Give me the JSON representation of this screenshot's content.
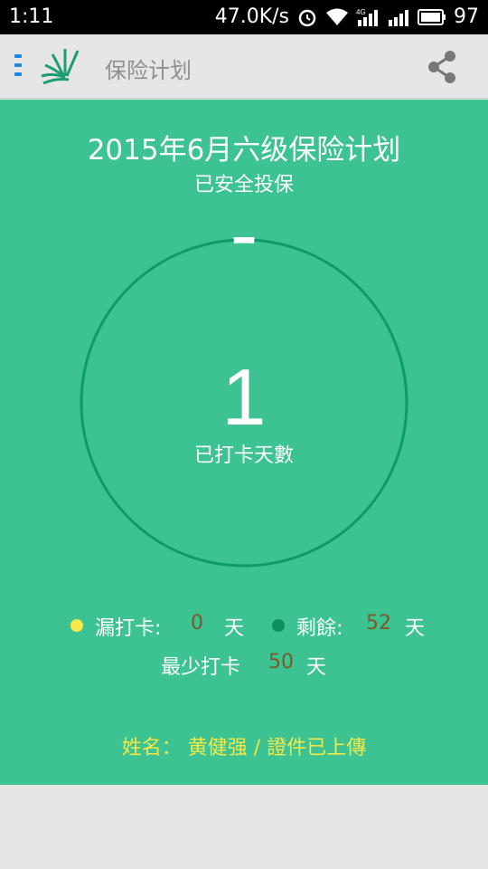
{
  "status_bar": {
    "time": "1:11",
    "speed": "47.0K/s",
    "network": "4G",
    "battery": "97"
  },
  "app_bar": {
    "title": "保险计划",
    "menu_icon": "menu-icon",
    "logo_icon": "leaf-logo-icon",
    "share_icon": "share-icon"
  },
  "plan": {
    "title": "2015年6月六级保险计划",
    "status": "已安全投保",
    "checkin_count": "1",
    "checkin_label": "已打卡天數",
    "progress_fraction": 0.02
  },
  "stats": {
    "missed_label": "漏打卡:",
    "missed_value": "0",
    "remaining_label": "剩餘:",
    "remaining_value": "52",
    "min_label": "最少打卡",
    "min_value": "50",
    "unit": "天"
  },
  "footer": {
    "name_line": "姓名： 黄健强 / 證件已上傳"
  },
  "colors": {
    "card_bg": "#3cc391",
    "ring": "#0f9a68",
    "missed_dot": "#f5e94a",
    "remaining_dot": "#0f8f5e",
    "number_text": "#7a5a2a",
    "name_text": "#f2e84a"
  }
}
